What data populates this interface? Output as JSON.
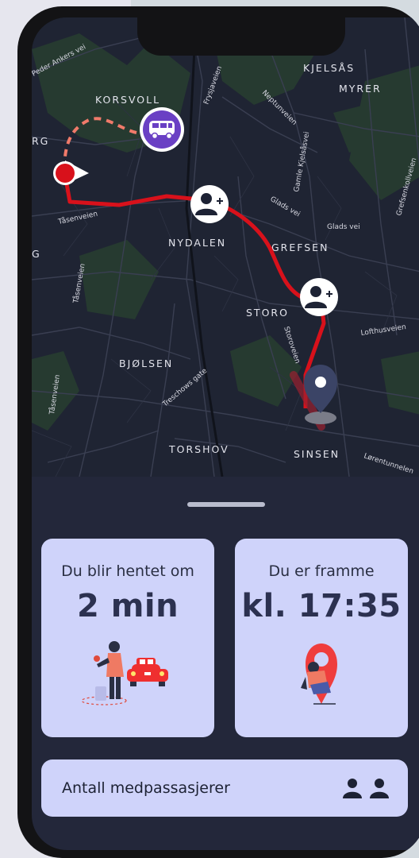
{
  "map": {
    "areas": [
      "KORSVOLL",
      "KJELSÅS",
      "MYRER",
      "NYDALEN",
      "GREFSEN",
      "STORO",
      "BJØLSEN",
      "TORSHOV",
      "SINSEN",
      "RG",
      "G"
    ],
    "streets": [
      "Peder Ankers vei",
      "Frysjaveien",
      "Neptunveien",
      "Gamle Kjelsåsvei",
      "Glads vei",
      "Glads vei",
      "Grefsenkollveien",
      "Tåsenveien",
      "Tåsenveien",
      "Tåsenveien",
      "Storoveien",
      "Lofthusveien",
      "Treschows gate",
      "Lørentunnelen"
    ],
    "colors": {
      "route": "#d8111b",
      "vehicle": "#6a40c4",
      "pin": "#3b4466"
    }
  },
  "pickup": {
    "label": "Du blir hentet om",
    "value": "2 min"
  },
  "arrival": {
    "label": "Du er framme",
    "value": "kl. 17:35"
  },
  "passengers": {
    "label": "Antall medpassasjerer",
    "icons": [
      "person-icon",
      "person-icon"
    ]
  }
}
